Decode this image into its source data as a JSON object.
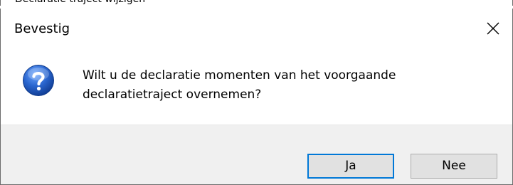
{
  "caption_fragment": "Declaratie traject wijzigen",
  "dialog": {
    "title": "Bevestig",
    "close_icon": "close-icon",
    "icon": "question-icon",
    "message_line1": "Wilt u de declaratie momenten van het voorgaande",
    "message_line2": "declaratietraject overnemen?"
  },
  "buttons": {
    "yes_label": "Ja",
    "no_label": "Nee"
  },
  "colors": {
    "default_button_border": "#0078d7",
    "footer_background": "#f0f0f0",
    "icon_blue": "#1f5fbf"
  }
}
